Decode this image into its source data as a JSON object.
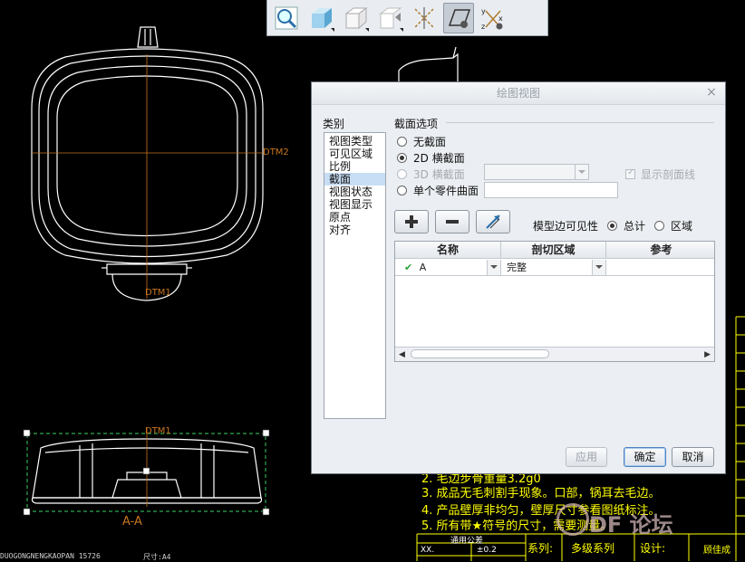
{
  "toolbar": {
    "buttons": [
      {
        "name": "zoom-icon"
      },
      {
        "name": "shaded-cube-icon"
      },
      {
        "name": "hidden-line-cube-icon"
      },
      {
        "name": "no-hidden-cube-icon"
      },
      {
        "name": "datum-axes-icon"
      },
      {
        "name": "datum-plane-icon"
      },
      {
        "name": "csys-icon"
      }
    ]
  },
  "dialog": {
    "title": "绘图视图",
    "close": "×",
    "categories_label": "类别",
    "categories": [
      {
        "label": "视图类型",
        "selected": false
      },
      {
        "label": "可见区域",
        "selected": false
      },
      {
        "label": "比例",
        "selected": false
      },
      {
        "label": "截面",
        "selected": true
      },
      {
        "label": "视图状态",
        "selected": false
      },
      {
        "label": "视图显示",
        "selected": false
      },
      {
        "label": "原点",
        "selected": false
      },
      {
        "label": "对齐",
        "selected": false
      }
    ],
    "section_options_label": "截面选项",
    "opt_none": "无截面",
    "opt_2d": "2D 横截面",
    "opt_3d": "3D 横截面",
    "opt_single": "单个零件曲面",
    "show_xhatch": "显示剖面线",
    "model_edge_vis": "模型边可见性",
    "vis_total": "总计",
    "vis_area": "区域",
    "table": {
      "headers": [
        "名称",
        "剖切区域",
        "参考"
      ],
      "row": {
        "name": "A",
        "area": "完整"
      }
    },
    "btn_apply": "应用",
    "btn_ok": "确定",
    "btn_cancel": "取消"
  },
  "drawing": {
    "datum_dtm2": "DTM2",
    "datum_dtm1_top": "DTM1",
    "datum_dtm1_bottom": "DTM1",
    "section_label": "A-A",
    "notes": [
      "2. 毛边步骨重量3.2g0",
      "3. 成品无毛刺割手现象。口部，锅耳去毛边。",
      "4. 产品壁厚非均匀，壁厚尺寸参看图纸标注。",
      "5. 所有带★符号的尺寸，需要测量。"
    ],
    "bottom_left": "DUOGONGNENGKAOPAN 15726",
    "size_label": "尺寸:A4",
    "tolerance_title": "通用公差",
    "tolerance_xx": "XX.",
    "tolerance_value": "±0.2",
    "title_block": [
      "系列:",
      "多级系列",
      "设计:",
      "顾佳成"
    ],
    "watermark": "DF 论坛"
  }
}
